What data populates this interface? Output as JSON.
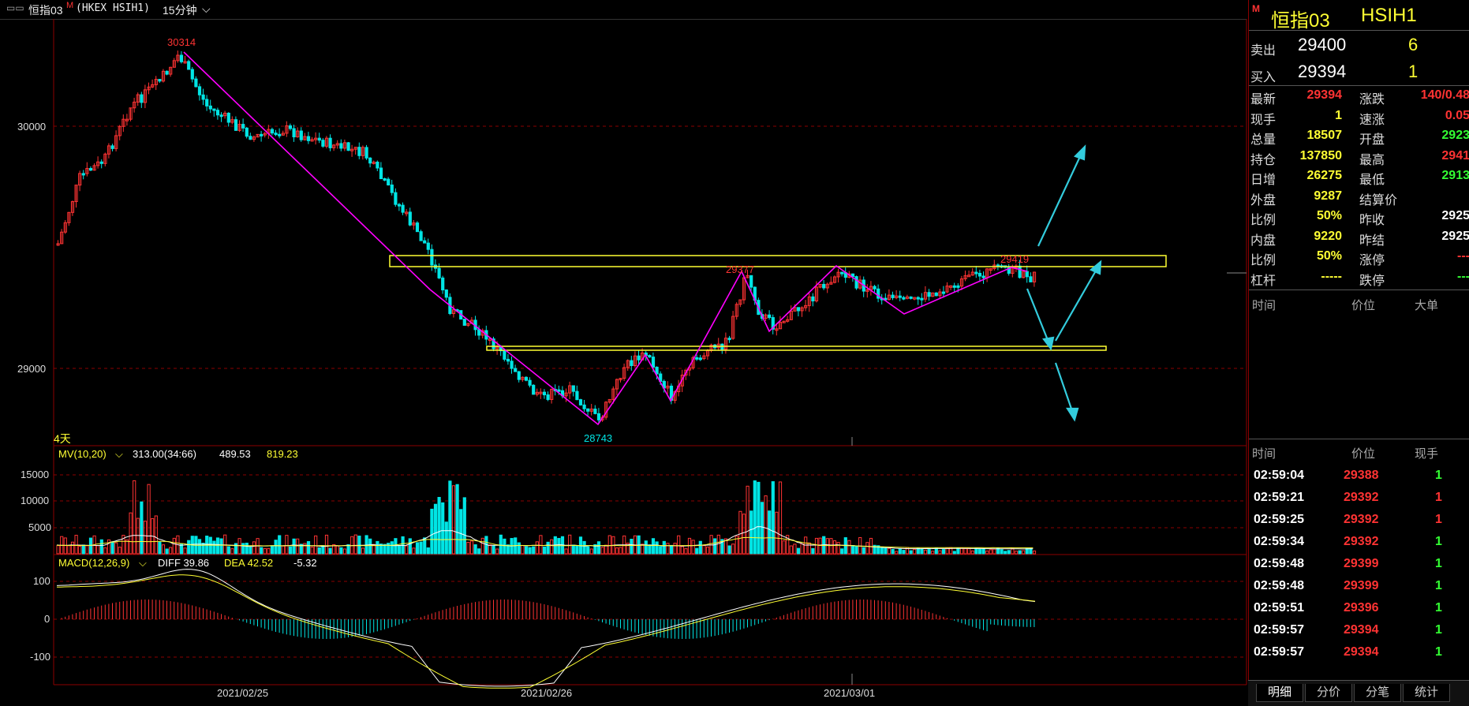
{
  "window": {
    "title": "恒指03",
    "title_mark": "M",
    "symbol_paren": "(HKEX HSIH1)",
    "period": "15分钟"
  },
  "main_chart": {
    "price_labels": [
      "30000",
      "29000"
    ],
    "peak_label": "30314",
    "trough_label": "28743",
    "mid_label": "29377",
    "right_label": "29419",
    "days_label": "4天",
    "colors": {
      "up": "#ff3333",
      "down": "#00e5e5",
      "zigzag": "#ff00ff",
      "box": "#ffff33",
      "arrow": "#33ccdd",
      "grid": "#8b0000"
    }
  },
  "volume_panel": {
    "indicator": "MV(10,20)",
    "value1": "313.00(34:66)",
    "value2": "489.53",
    "value3": "819.23",
    "axis_labels": [
      "15000",
      "10000",
      "5000"
    ]
  },
  "macd_panel": {
    "indicator": "MACD(12,26,9)",
    "diff": "DIFF 39.86",
    "dea": "DEA 42.52",
    "macd": "-5.32",
    "axis_labels": [
      "100",
      "0",
      "-100"
    ]
  },
  "x_axis": {
    "dates": [
      "2021/02/25",
      "2021/02/26",
      "2021/03/01"
    ]
  },
  "quote": {
    "name": "恒指03",
    "code": "HSIH1",
    "mark": "M",
    "sell_label": "卖出",
    "sell_price": "29400",
    "sell_qty": "6",
    "buy_label": "买入",
    "buy_price": "29394",
    "buy_qty": "1",
    "rows": [
      {
        "l1": "最新",
        "v1": "29394",
        "c1": "red",
        "l2": "涨跌",
        "v2": "140/0.48",
        "c2": "red"
      },
      {
        "l1": "现手",
        "v1": "1",
        "c1": "yel",
        "l2": "速涨",
        "v2": "0.05",
        "c2": "red"
      },
      {
        "l1": "总量",
        "v1": "18507",
        "c1": "yel",
        "l2": "开盘",
        "v2": "2923",
        "c2": "grn"
      },
      {
        "l1": "持仓",
        "v1": "137850",
        "c1": "yel",
        "l2": "最高",
        "v2": "2941",
        "c2": "red"
      },
      {
        "l1": "日增",
        "v1": "26275",
        "c1": "yel",
        "l2": "最低",
        "v2": "2913",
        "c2": "grn"
      },
      {
        "l1": "外盘",
        "v1": "9287",
        "c1": "yel",
        "l2": "结算价",
        "v2": "",
        "c2": "wht"
      },
      {
        "l1": "比例",
        "v1": "50%",
        "c1": "yel",
        "l2": "昨收",
        "v2": "2925",
        "c2": "wht"
      },
      {
        "l1": "内盘",
        "v1": "9220",
        "c1": "yel",
        "l2": "昨结",
        "v2": "2925",
        "c2": "wht"
      },
      {
        "l1": "比例",
        "v1": "50%",
        "c1": "yel",
        "l2": "涨停",
        "v2": "---",
        "c2": "red"
      },
      {
        "l1": "杠杆",
        "v1": "-----",
        "c1": "yel",
        "l2": "跌停",
        "v2": "---",
        "c2": "grn"
      }
    ],
    "big_header": [
      "时间",
      "价位",
      "大单"
    ],
    "tick_header": [
      "时间",
      "价位",
      "现手"
    ],
    "ticks": [
      {
        "time": "02:59:04",
        "price": "29388",
        "qty": "1",
        "qc": "grn"
      },
      {
        "time": "02:59:21",
        "price": "29392",
        "qty": "1",
        "qc": "red"
      },
      {
        "time": "02:59:25",
        "price": "29392",
        "qty": "1",
        "qc": "red"
      },
      {
        "time": "02:59:34",
        "price": "29392",
        "qty": "1",
        "qc": "grn"
      },
      {
        "time": "02:59:48",
        "price": "29399",
        "qty": "1",
        "qc": "grn"
      },
      {
        "time": "02:59:48",
        "price": "29399",
        "qty": "1",
        "qc": "grn"
      },
      {
        "time": "02:59:51",
        "price": "29396",
        "qty": "1",
        "qc": "grn"
      },
      {
        "time": "02:59:57",
        "price": "29394",
        "qty": "1",
        "qc": "grn"
      },
      {
        "time": "02:59:57",
        "price": "29394",
        "qty": "1",
        "qc": "grn"
      }
    ],
    "tabs": [
      "明细",
      "分价",
      "分笔",
      "统计"
    ]
  }
}
